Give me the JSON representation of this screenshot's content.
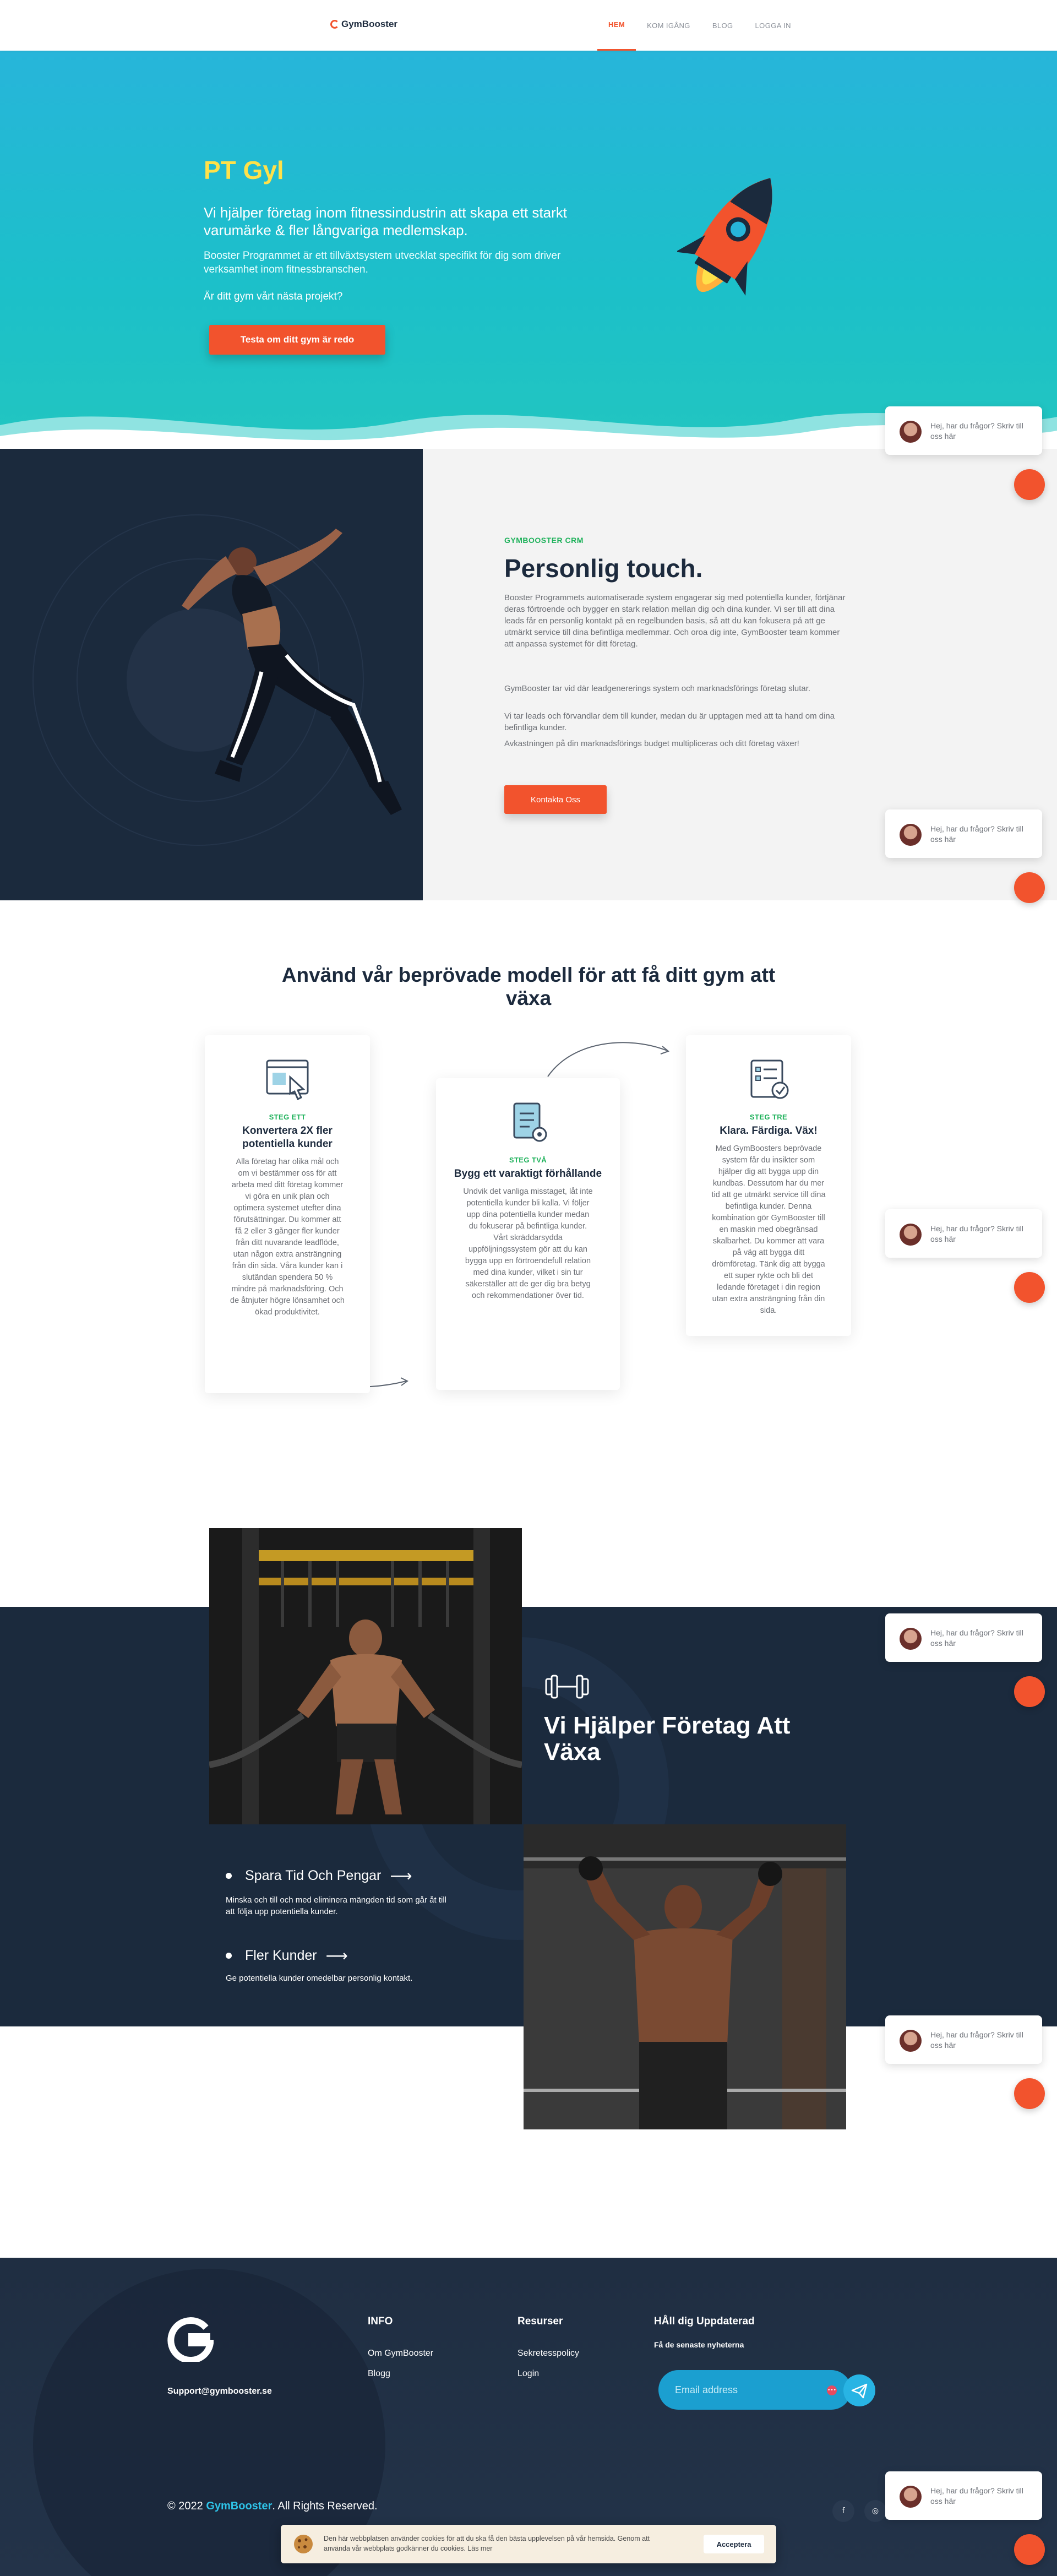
{
  "header": {
    "logo_text": "GymBooster",
    "nav": [
      {
        "label": "HEM",
        "active": true
      },
      {
        "label": "KOM IGÅNG",
        "active": false
      },
      {
        "label": "BLOG",
        "active": false
      },
      {
        "label": "LOGGA IN",
        "active": false
      }
    ]
  },
  "hero": {
    "title": "PT Gyl",
    "lead": "Vi hjälper företag inom fitnessindustrin att skapa ett starkt varumärke & fler långvariga medlemskap.",
    "sub": "Booster Programmet är ett tillväxtsystem utvecklat specifikt för dig som driver verksamhet inom fitnessbranschen.",
    "question": "Är ditt gym vårt nästa projekt?",
    "cta": "Testa om ditt gym är redo"
  },
  "crm": {
    "eyebrow": "GYMBOOSTER CRM",
    "title": "Personlig touch.",
    "p1": "Booster Programmets automatiserade system engagerar sig med potentiella kunder, förtjänar deras förtroende och bygger en stark relation mellan dig och dina kunder. Vi ser till att dina leads får en personlig kontakt på en regelbunden basis, så att du kan fokusera på att ge utmärkt service till dina befintliga medlemmar. Och oroa dig inte, GymBooster team kommer att anpassa systemet för ditt företag.",
    "p2": "GymBooster tar vid där leadgenererings system och marknadsförings företag slutar.",
    "p3": "Vi tar leads och förvandlar dem till kunder, medan du är upptagen med att ta hand om dina befintliga kunder.",
    "p4": "Avkastningen på din marknadsförings budget multipliceras och ditt företag växer!",
    "button": "Kontakta Oss"
  },
  "steps": {
    "title": "Använd vår beprövade modell för att få ditt gym att växa",
    "cards": [
      {
        "step": "STEG ETT",
        "title": "Konvertera 2X fler potentiella kunder",
        "body": "Alla företag har olika mål och om vi bestämmer oss för att arbeta med ditt företag kommer vi göra en unik plan och optimera systemet utefter dina förutsättningar. Du kommer att få 2 eller 3 gånger fler kunder från ditt nuvarande leadflöde, utan någon extra ansträngning från din sida. Våra kunder kan i slutändan spendera 50 % mindre på marknadsföring. Och de åtnjuter högre lönsamhet och ökad produktivitet."
      },
      {
        "step": "STEG TVÅ",
        "title": "Bygg ett varaktigt förhållande",
        "body": "Undvik det vanliga misstaget, låt inte potentiella kunder bli kalla. Vi följer upp dina potentiella kunder medan du fokuserar på befintliga kunder. Vårt skräddarsydda uppföljningssystem gör att du kan bygga upp en förtroendefull relation med dina kunder, vilket i sin tur säkerställer att de ger dig bra betyg och rekommendationer över tid."
      },
      {
        "step": "STEG TRE",
        "title": "Klara. Färdiga. Väx!",
        "body": "Med GymBoosters beprövade system får du insikter som hjälper dig att bygga upp din kundbas. Dessutom har du mer tid att ge utmärkt service till dina befintliga kunder. Denna kombination gör GymBooster till en maskin med obegränsad skalbarhet. Du kommer att vara på väg att bygga ditt drömföretag. Tänk dig att byggа ett super rykte och bli det ledande företaget i din region utan extra ansträngning från din sida."
      }
    ]
  },
  "grow": {
    "title": "Vi Hjälper Företag Att Växa",
    "items": [
      {
        "heading": "Spara Tid Och Pengar",
        "text": "Minska och till och med eliminera mängden tid som går åt till att följa upp potentiella kunder."
      },
      {
        "heading": "Fler Kunder",
        "text": "Ge potentiella kunder omedelbar personlig kontakt."
      }
    ]
  },
  "footer": {
    "email": "Support@gymbooster.se",
    "info_heading": "INFO",
    "info_links": [
      "Om GymBooster",
      "Blogg"
    ],
    "resources_heading": "Resurser",
    "resources_links": [
      "Sekretesspolicy",
      "Login"
    ],
    "news_heading": "HÅll dig Uppdaterad",
    "news_sub": "Få de senaste nyheterna",
    "email_placeholder": "Email address",
    "badge": "•••",
    "copyright_prefix": "© 2022 ",
    "copyright_brand": "GymBooster",
    "copyright_suffix": ". All Rights Reserved.",
    "social": [
      "f",
      "◎"
    ]
  },
  "cookie": {
    "text": "Den här webbplatsen använder cookies för att du ska få den bästa upplevelsen på vår hemsida. Genom att använda vår webbplats godkänner du cookies. Läs mer",
    "button": "Acceptera"
  },
  "chat": {
    "message": "Hej, har du frågor? Skriv till oss här"
  },
  "colors": {
    "accent": "#f2532d",
    "navy": "#1b2a3d",
    "green": "#1db15a",
    "hero_yellow": "#ffe14a",
    "hero_teal": "#1cc0c9"
  }
}
